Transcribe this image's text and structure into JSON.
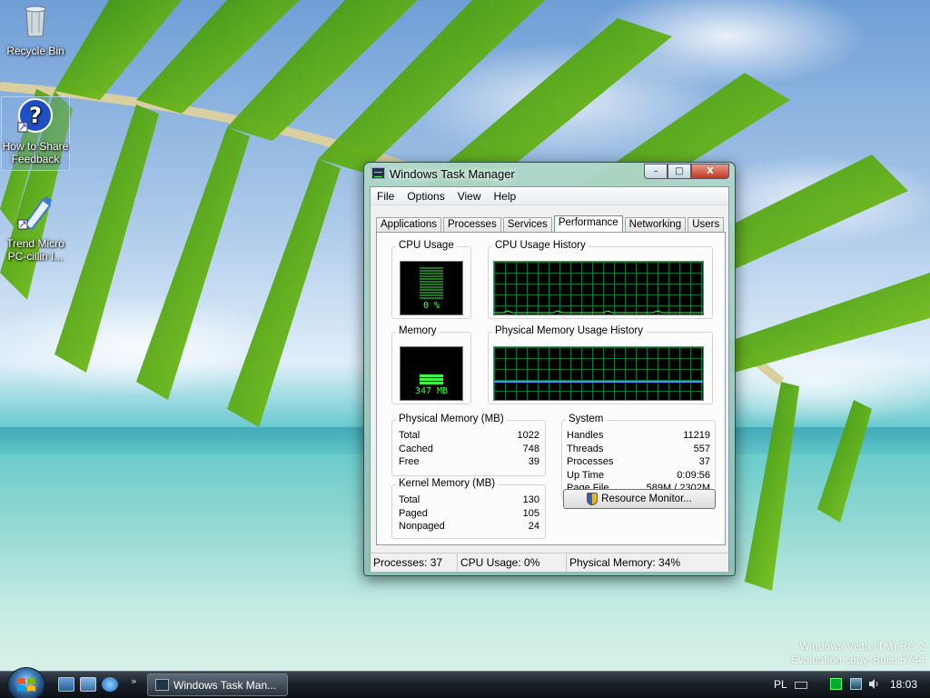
{
  "desktop": {
    "icons": [
      {
        "label": "Recycle Bin"
      },
      {
        "label": "How to Share Feedback"
      },
      {
        "label": "Trend Micro PC-cillin I..."
      }
    ],
    "watermark": [
      "Windows Vista (TM) RC 2",
      "Evaluation copy. Build 5744"
    ]
  },
  "window": {
    "title": "Windows Task Manager",
    "buttons": {
      "minimize": "–",
      "maximize": "□",
      "close": "X"
    },
    "menu": [
      "File",
      "Options",
      "View",
      "Help"
    ],
    "tabs": [
      "Applications",
      "Processes",
      "Services",
      "Performance",
      "Networking",
      "Users"
    ],
    "active_tab": "Performance",
    "performance": {
      "cpu_usage": {
        "label": "CPU Usage",
        "value": "0 %",
        "level": 0.0
      },
      "cpu_history": {
        "label": "CPU Usage History"
      },
      "memory": {
        "label": "Memory",
        "value": "347 MB",
        "level": 0.34
      },
      "mem_history": {
        "label": "Physical Memory Usage History",
        "level": 0.34
      },
      "physical_memory": {
        "label": "Physical Memory (MB)",
        "rows": [
          {
            "name": "Total",
            "value": "1022"
          },
          {
            "name": "Cached",
            "value": "748"
          },
          {
            "name": "Free",
            "value": "39"
          }
        ]
      },
      "kernel_memory": {
        "label": "Kernel Memory (MB)",
        "rows": [
          {
            "name": "Total",
            "value": "130"
          },
          {
            "name": "Paged",
            "value": "105"
          },
          {
            "name": "Nonpaged",
            "value": "24"
          }
        ]
      },
      "system": {
        "label": "System",
        "rows": [
          {
            "name": "Handles",
            "value": "11219"
          },
          {
            "name": "Threads",
            "value": "557"
          },
          {
            "name": "Processes",
            "value": "37"
          },
          {
            "name": "Up Time",
            "value": "0:09:56"
          },
          {
            "name": "Page File",
            "value": "589M / 2302M"
          }
        ]
      },
      "resource_monitor_label": "Resource Monitor..."
    },
    "status": {
      "processes": "Processes: 37",
      "cpu": "CPU Usage: 0%",
      "memory": "Physical Memory: 34%"
    }
  },
  "taskbar": {
    "task_label": "Windows Task Man...",
    "language": "PL",
    "clock": "18:03"
  },
  "colors": {
    "graph_line": "#37ff37",
    "mem_line": "#4f8fff",
    "grid": "#008a3c"
  }
}
